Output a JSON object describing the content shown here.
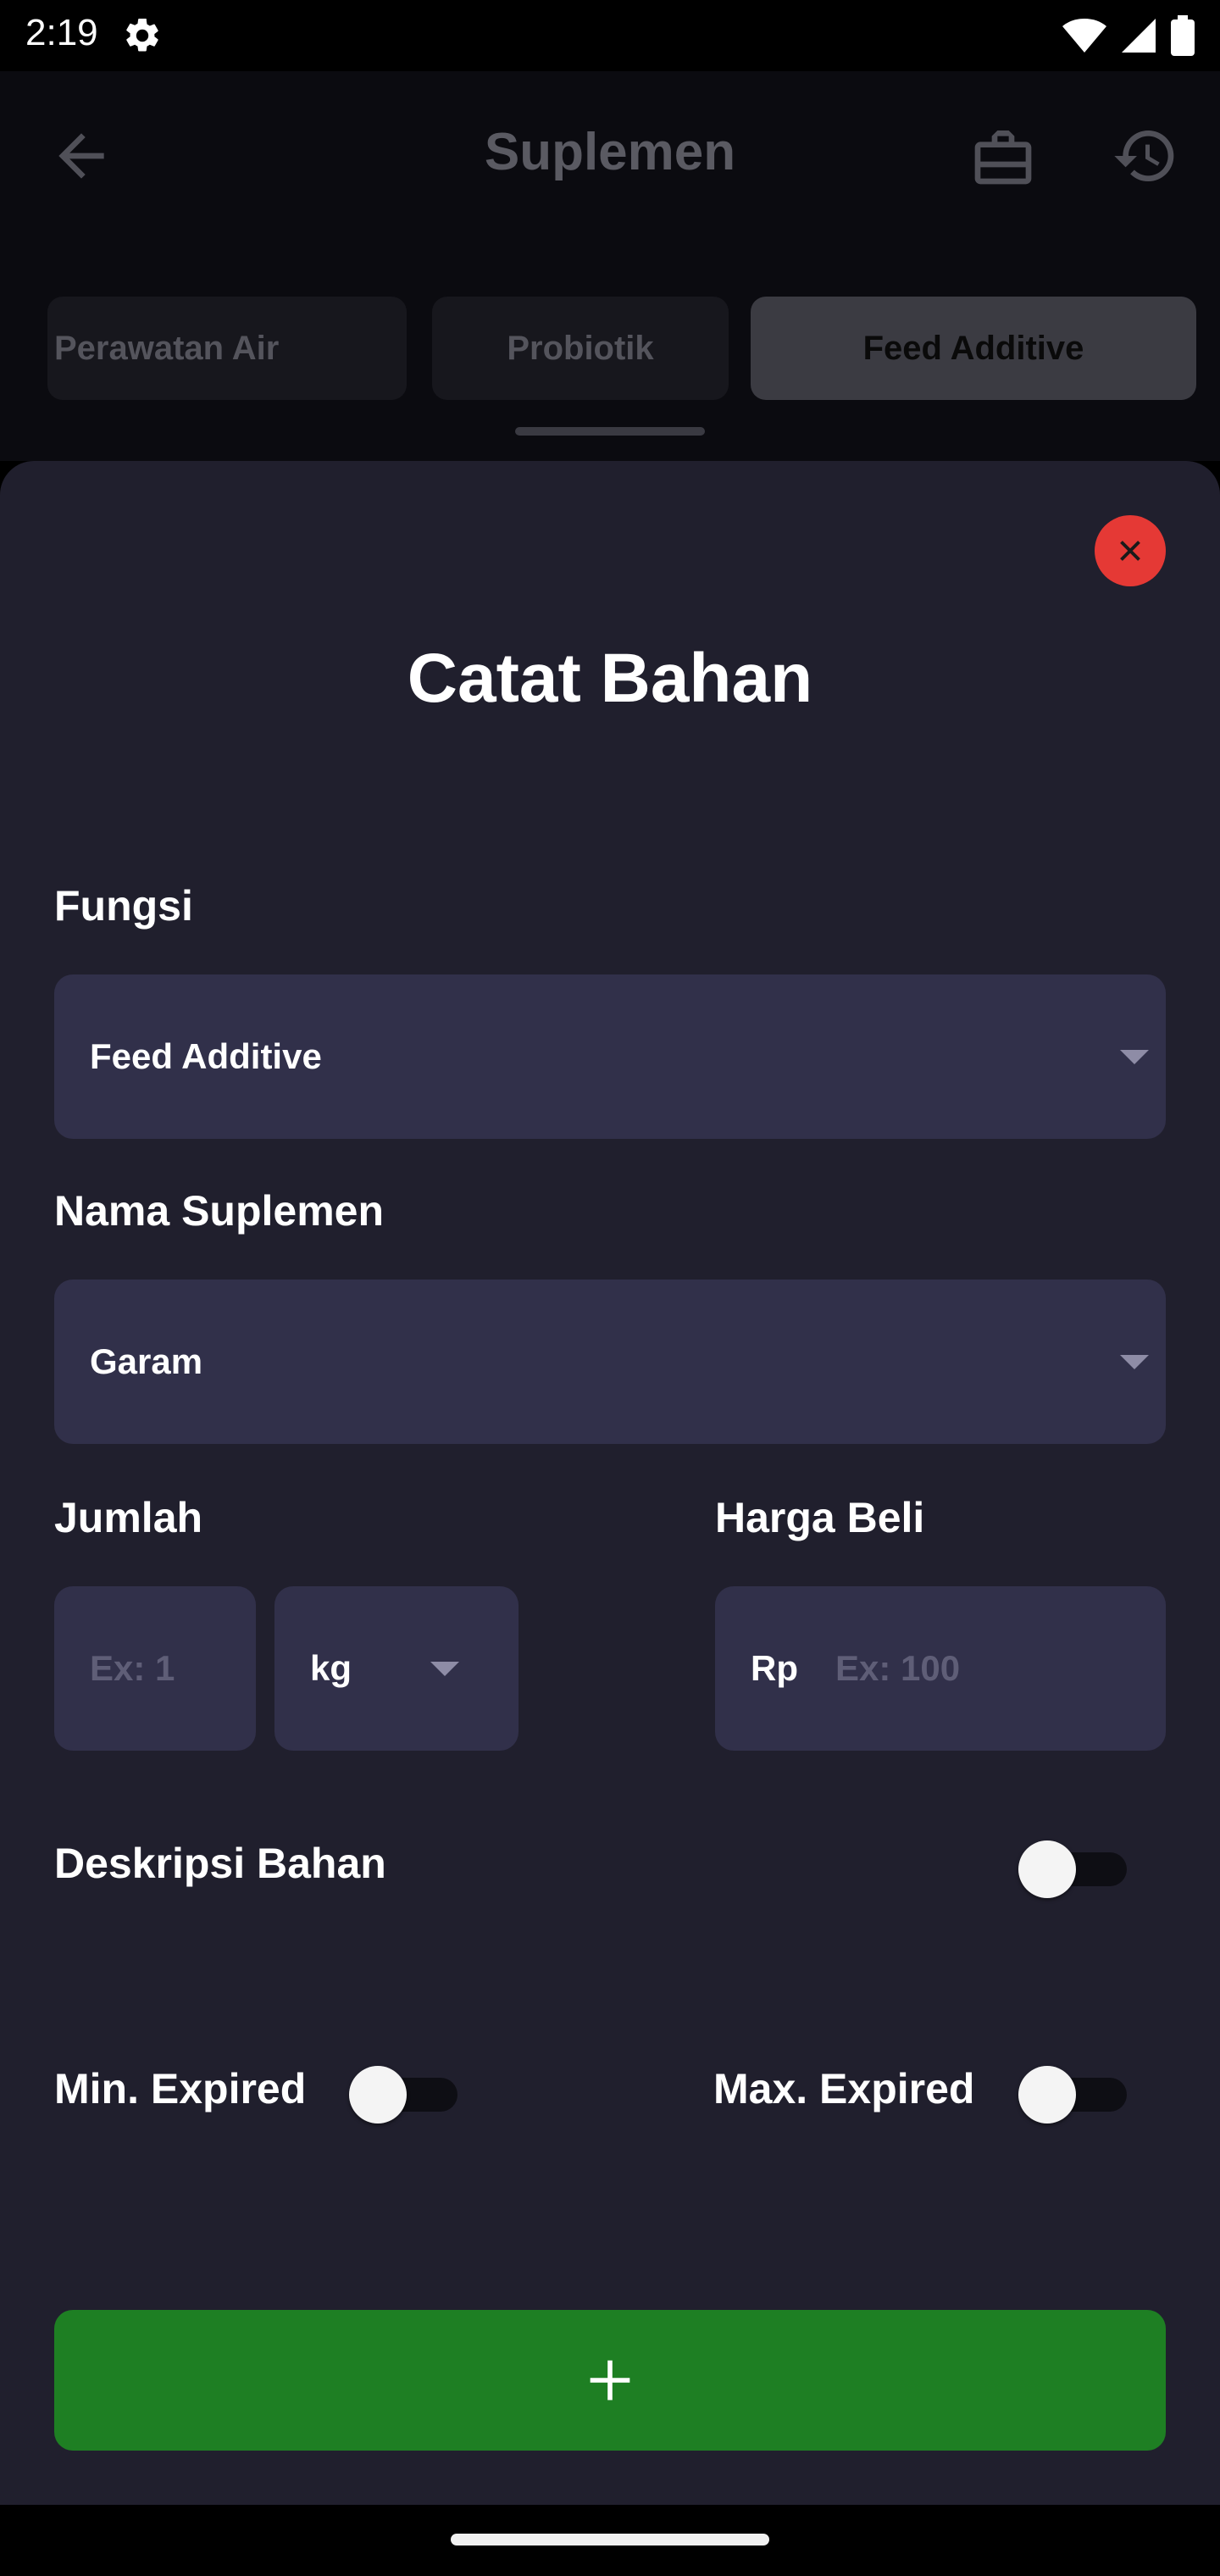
{
  "status": {
    "time": "2:19"
  },
  "app": {
    "title": "Suplemen",
    "tabs": [
      {
        "label": "Perawatan Air",
        "active": false
      },
      {
        "label": "Probiotik",
        "active": false
      },
      {
        "label": "Feed Additive",
        "active": true
      }
    ]
  },
  "sheet": {
    "title": "Catat Bahan",
    "fungsi": {
      "label": "Fungsi",
      "value": "Feed Additive"
    },
    "nama_suplemen": {
      "label": "Nama Suplemen",
      "value": "Garam"
    },
    "jumlah": {
      "label": "Jumlah",
      "placeholder": "Ex: 1",
      "unit": "kg"
    },
    "harga_beli": {
      "label": "Harga Beli",
      "prefix": "Rp",
      "placeholder": "Ex: 100"
    },
    "deskripsi": {
      "label": "Deskripsi Bahan",
      "enabled": false
    },
    "min_expired": {
      "label": "Min. Expired",
      "enabled": false
    },
    "max_expired": {
      "label": "Max. Expired",
      "enabled": false
    }
  },
  "colors": {
    "sheet_bg": "#201f2d",
    "field_bg": "#31304a",
    "close_red": "#e53935",
    "add_green": "#1e7f23"
  },
  "icons": [
    "settings-gear-icon",
    "wifi-icon",
    "signal-icon",
    "battery-icon",
    "back-arrow-icon",
    "briefcase-icon",
    "history-icon",
    "close-icon",
    "dropdown-caret-icon",
    "plus-icon"
  ]
}
